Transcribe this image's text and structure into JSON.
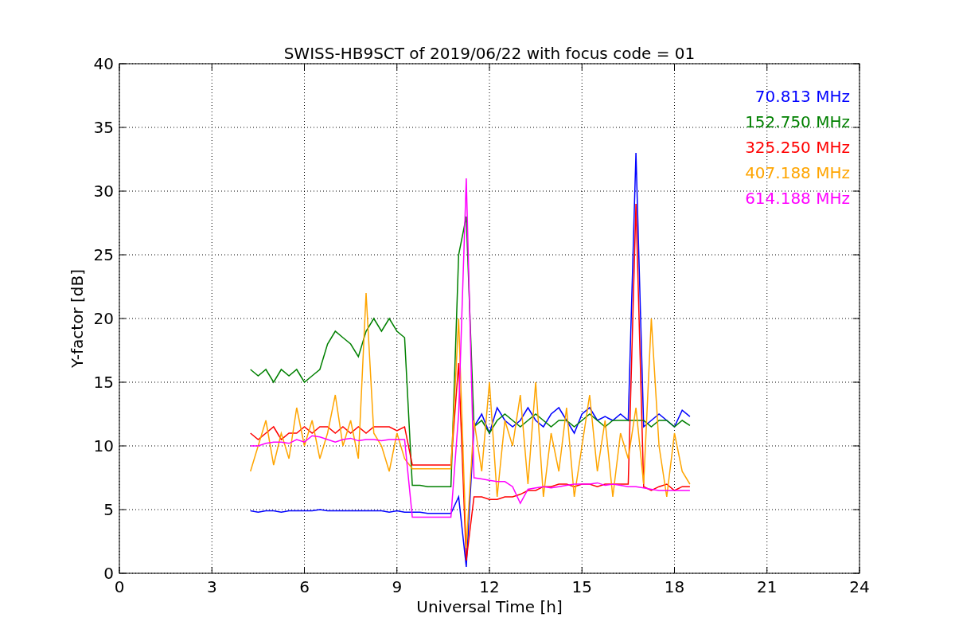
{
  "figure": {
    "chart_data": {
      "type": "line",
      "title": "SWISS-HB9SCT of 2019/06/22 with focus code = 01",
      "xlabel": "Universal Time [h]",
      "ylabel": "Y-factor [dB]",
      "xlim": [
        0,
        24
      ],
      "ylim": [
        0,
        40
      ],
      "xticks": [
        0,
        3,
        6,
        9,
        12,
        15,
        18,
        21,
        24
      ],
      "yticks": [
        0,
        5,
        10,
        15,
        20,
        25,
        30,
        35,
        40
      ],
      "grid": true,
      "x": [
        4.25,
        4.5,
        4.75,
        5,
        5.25,
        5.5,
        5.75,
        6,
        6.25,
        6.5,
        6.75,
        7,
        7.25,
        7.5,
        7.75,
        8,
        8.25,
        8.5,
        8.75,
        9,
        9.25,
        9.5,
        9.75,
        10,
        10.25,
        10.5,
        10.75,
        11,
        11.25,
        11.5,
        11.75,
        12,
        12.25,
        12.5,
        12.75,
        13,
        13.25,
        13.5,
        13.75,
        14,
        14.25,
        14.5,
        14.75,
        15,
        15.25,
        15.5,
        15.75,
        16,
        16.25,
        16.5,
        16.75,
        17,
        17.25,
        17.5,
        17.75,
        18,
        18.25,
        18.5
      ],
      "series": [
        {
          "name": "70.813 MHz",
          "color": "#0000ff",
          "values": [
            4.9,
            4.8,
            4.9,
            4.9,
            4.8,
            4.9,
            4.9,
            4.9,
            4.9,
            5.0,
            4.9,
            4.9,
            4.9,
            4.9,
            4.9,
            4.9,
            4.9,
            4.9,
            4.8,
            4.9,
            4.8,
            4.8,
            4.8,
            4.7,
            4.7,
            4.7,
            4.7,
            6.0,
            0.5,
            11.5,
            12.5,
            11,
            13,
            12,
            11.5,
            12,
            13,
            12,
            11.5,
            12.5,
            13,
            12,
            11,
            12.5,
            13,
            12,
            12.3,
            12,
            12.5,
            12,
            33,
            11.5,
            12,
            12.5,
            12,
            11.5,
            12.8,
            12.3
          ]
        },
        {
          "name": "152.750 MHz",
          "color": "#008000",
          "values": [
            16,
            15.5,
            16,
            15,
            16,
            15.5,
            16,
            15,
            15.5,
            16,
            18,
            19,
            18.5,
            18,
            17,
            19,
            20,
            19,
            20,
            19,
            18.5,
            6.9,
            6.9,
            6.8,
            6.8,
            6.8,
            6.8,
            25,
            28,
            11.5,
            12,
            11,
            12,
            12.5,
            12,
            11.5,
            12,
            12.5,
            12,
            11.5,
            12,
            12,
            11.5,
            12,
            12.5,
            12,
            11.5,
            12,
            12,
            12,
            12,
            12,
            11.5,
            12,
            12,
            11.5,
            12,
            11.6
          ]
        },
        {
          "name": "325.250 MHz",
          "color": "#ff0000",
          "values": [
            11,
            10.5,
            11,
            11.5,
            10.5,
            11,
            11,
            11.5,
            11,
            11.5,
            11.5,
            11,
            11.5,
            11,
            11.5,
            11,
            11.5,
            11.5,
            11.5,
            11.2,
            11.5,
            8.5,
            8.5,
            8.5,
            8.5,
            8.5,
            8.5,
            16.5,
            1,
            6,
            6,
            5.8,
            5.8,
            6,
            6,
            6.2,
            6.5,
            6.5,
            6.8,
            6.8,
            7,
            7,
            6.8,
            7,
            7,
            6.8,
            7,
            7,
            7,
            7,
            29,
            6.8,
            6.5,
            6.8,
            7,
            6.5,
            6.8,
            6.8
          ]
        },
        {
          "name": "407.188 MHz",
          "color": "#ffa500",
          "values": [
            8,
            10,
            12,
            8.5,
            11,
            9,
            13,
            10,
            12,
            9,
            11,
            14,
            10,
            12,
            9,
            22,
            11,
            10,
            8,
            11,
            9,
            8.2,
            8.2,
            8.2,
            8.2,
            8.2,
            8.2,
            20,
            2,
            12,
            8,
            15,
            6,
            12,
            10,
            14,
            7,
            15,
            6,
            11,
            8,
            13,
            6,
            10,
            14,
            8,
            12,
            6,
            11,
            9,
            13,
            7,
            20,
            10,
            6,
            11,
            8,
            7
          ]
        },
        {
          "name": "614.188 MHz",
          "color": "#ff00ff",
          "values": [
            10,
            10,
            10.2,
            10.3,
            10.3,
            10.2,
            10.5,
            10.3,
            10.8,
            10.7,
            10.5,
            10.3,
            10.5,
            10.6,
            10.4,
            10.5,
            10.5,
            10.4,
            10.5,
            10.5,
            10.5,
            4.4,
            4.4,
            4.4,
            4.4,
            4.4,
            4.4,
            12.5,
            31,
            7.5,
            7.4,
            7.3,
            7.2,
            7.2,
            6.8,
            5.5,
            6.6,
            6.7,
            6.8,
            6.7,
            6.8,
            6.9,
            7.0,
            7.0,
            7.0,
            7.1,
            6.9,
            7.0,
            6.9,
            6.8,
            6.8,
            6.7,
            6.6,
            6.5,
            6.5,
            6.5,
            6.5,
            6.5
          ]
        }
      ]
    }
  }
}
